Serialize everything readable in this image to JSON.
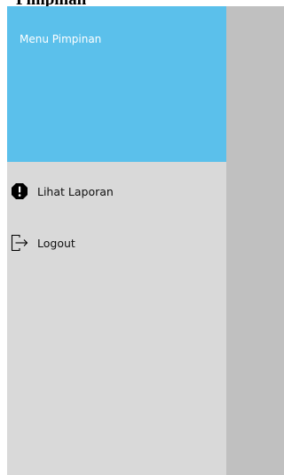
{
  "page": {
    "top_text": "Pimpinan"
  },
  "drawer": {
    "title": "Menu Pimpinan",
    "items": [
      {
        "label": "Lihat Laporan",
        "icon": "alert-octagon-icon"
      },
      {
        "label": "Logout",
        "icon": "logout-icon"
      }
    ]
  },
  "colors": {
    "header": "#5bc0eb",
    "drawer_bg": "#d9d9d9",
    "overlay": "#c0c0c0"
  }
}
